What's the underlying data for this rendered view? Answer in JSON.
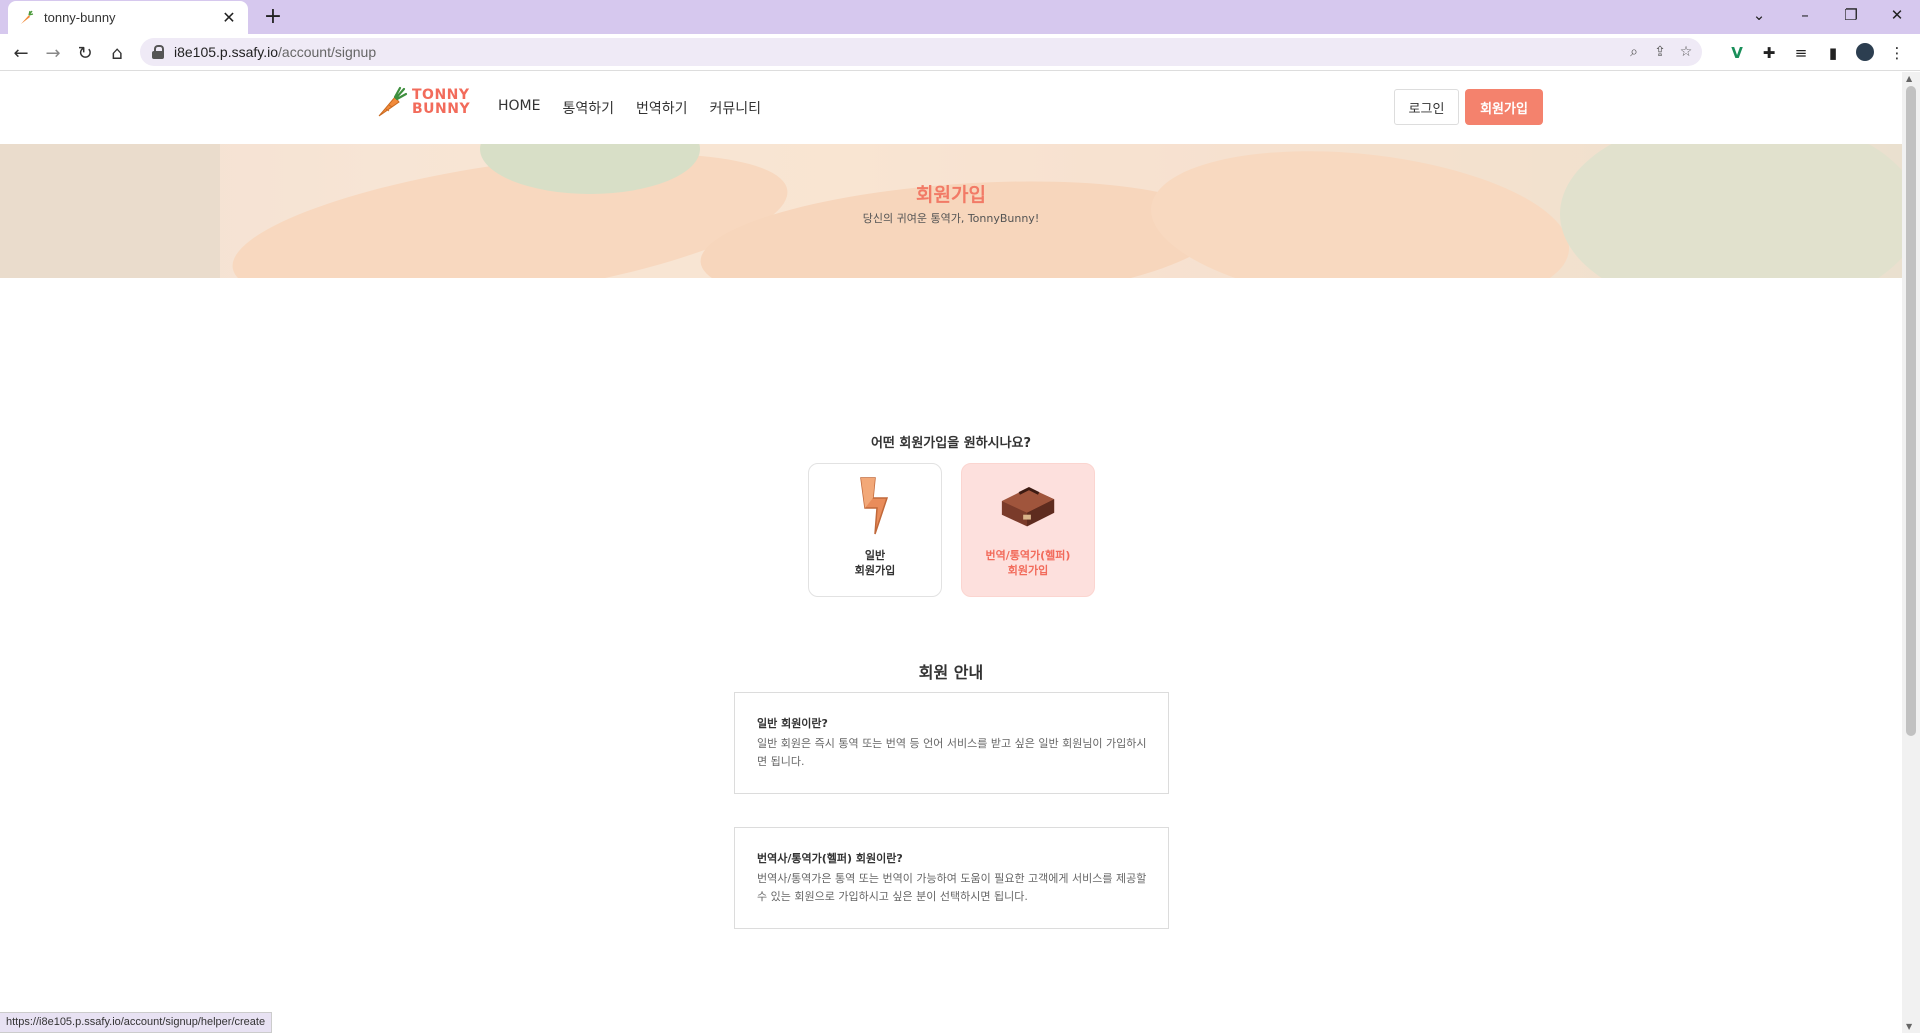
{
  "browser": {
    "tab_title": "tonny-bunny",
    "url_host": "i8e105.p.ssafy.io",
    "url_path": "/account/signup",
    "status_url": "https://i8e105.p.ssafy.io/account/signup/helper/create"
  },
  "header": {
    "logo_line1": "TONNY",
    "logo_line2": "BUNNY",
    "nav": [
      "HOME",
      "통역하기",
      "번역하기",
      "커뮤니티"
    ],
    "login_label": "로그인",
    "signup_label": "회원가입"
  },
  "hero": {
    "title": "회원가입",
    "subtitle": "당신의 귀여운 통역가, TonnyBunny!"
  },
  "main": {
    "question": "어떤 회원가입을 원하시나요?",
    "cards": [
      {
        "line1": "일반",
        "line2": "회원가입"
      },
      {
        "line1": "번역/통역가(헬퍼)",
        "line2": "회원가입"
      }
    ],
    "info_title": "회원 안내",
    "info": [
      {
        "heading": "일반 회원이란?",
        "text": "일반 회원은 즉시 통역 또는 번역 등 언어 서비스를 받고 싶은 일반 회원님이 가입하시면 됩니다."
      },
      {
        "heading": "번역사/통역가(헬퍼) 회원이란?",
        "text": "번역사/통역가은 통역 또는 번역이 가능하여 도움이 필요한 고객에게 서비스를 제공할 수 있는 회원으로 가입하시고 싶은 분이 선택하시면 됩니다."
      }
    ]
  },
  "colors": {
    "accent": "#f4826d",
    "accent_text": "#f26b5b",
    "helper_card_bg": "#fde0dd"
  }
}
